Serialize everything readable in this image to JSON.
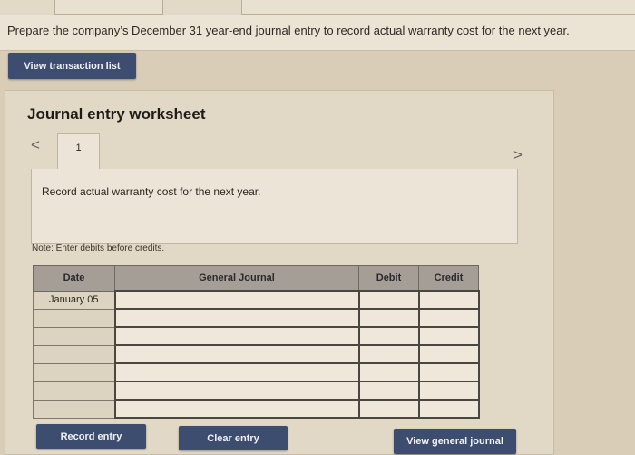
{
  "instruction": "Prepare the company’s December 31 year-end journal entry to record actual warranty cost for the next year.",
  "buttons": {
    "view_transaction_list": "View transaction list",
    "record_entry": "Record entry",
    "clear_entry": "Clear entry",
    "view_general_journal": "View general journal"
  },
  "worksheet": {
    "title": "Journal entry worksheet",
    "tab_number": "1",
    "description": "Record actual warranty cost for the next year.",
    "note": "Note: Enter debits before credits."
  },
  "journal_table": {
    "headers": {
      "date": "Date",
      "general_journal": "General Journal",
      "debit": "Debit",
      "credit": "Credit"
    },
    "rows": [
      {
        "date": "January 05",
        "account": "",
        "debit": "",
        "credit": ""
      },
      {
        "date": "",
        "account": "",
        "debit": "",
        "credit": ""
      },
      {
        "date": "",
        "account": "",
        "debit": "",
        "credit": ""
      },
      {
        "date": "",
        "account": "",
        "debit": "",
        "credit": ""
      },
      {
        "date": "",
        "account": "",
        "debit": "",
        "credit": ""
      },
      {
        "date": "",
        "account": "",
        "debit": "",
        "credit": ""
      },
      {
        "date": "",
        "account": "",
        "debit": "",
        "credit": ""
      }
    ]
  },
  "icons": {
    "prev": "chevron-left-icon",
    "next": "chevron-right-icon"
  },
  "colors": {
    "button_bg": "#3d4d70",
    "header_bg": "#a49e96",
    "page_bg": "#d9cdb8"
  }
}
